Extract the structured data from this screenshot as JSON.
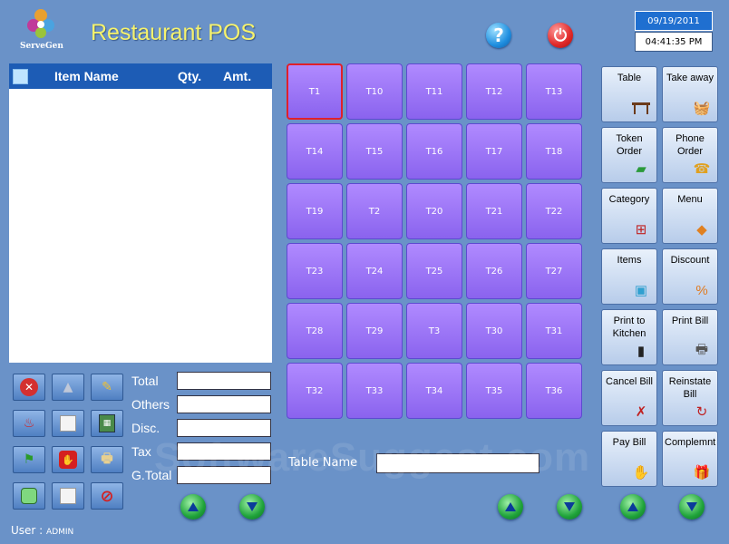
{
  "app": {
    "brand": "ServeGen",
    "title": "Restaurant POS"
  },
  "header": {
    "date": "09/19/2011",
    "time": "04:41:35 PM",
    "help_icon": "question-icon",
    "power_icon": "power-icon"
  },
  "order": {
    "columns": {
      "item": "Item Name",
      "qty": "Qty.",
      "amt": "Amt."
    },
    "rows": []
  },
  "toolbar": {
    "icons": [
      "cancel-icon",
      "weight-icon",
      "pencil-icon",
      "chili-icon",
      "note-icon",
      "calculator-icon",
      "flag-icon",
      "stop-icon",
      "printer-icon",
      "square-icon",
      "page-icon",
      "no-entry-icon"
    ]
  },
  "totals": {
    "total": "Total",
    "others": "Others",
    "disc": "Disc.",
    "tax": "Tax",
    "gtotal": "G.Total"
  },
  "tables": [
    "T1",
    "T10",
    "T11",
    "T12",
    "T13",
    "T14",
    "T15",
    "T16",
    "T17",
    "T18",
    "T19",
    "T2",
    "T20",
    "T21",
    "T22",
    "T23",
    "T24",
    "T25",
    "T26",
    "T27",
    "T28",
    "T29",
    "T3",
    "T30",
    "T31",
    "T32",
    "T33",
    "T34",
    "T35",
    "T36"
  ],
  "selected_table": "T1",
  "table_name_label": "Table Name",
  "functions": [
    {
      "label": "Table",
      "icon": "table-icon"
    },
    {
      "label": "Take away",
      "icon": "basket-icon"
    },
    {
      "label": "Token Order",
      "icon": "token-icon"
    },
    {
      "label": "Phone Order",
      "icon": "phone-icon"
    },
    {
      "label": "Category",
      "icon": "hierarchy-icon"
    },
    {
      "label": "Menu",
      "icon": "menu-icon"
    },
    {
      "label": "Items",
      "icon": "cubes-icon"
    },
    {
      "label": "Discount",
      "icon": "percent-icon"
    },
    {
      "label": "Print to Kitchen",
      "icon": "kitchen-printer-icon"
    },
    {
      "label": "Print Bill",
      "icon": "printer-icon"
    },
    {
      "label": "Cancel Bill",
      "icon": "cancel-bill-icon"
    },
    {
      "label": "Reinstate Bill",
      "icon": "reinstate-icon"
    },
    {
      "label": "Pay Bill",
      "icon": "pay-icon"
    },
    {
      "label": "Complemnt",
      "icon": "gift-icon"
    }
  ],
  "user": {
    "label": "User :",
    "name": "ADMIN"
  },
  "watermark": "SoftwareSuggest.com"
}
